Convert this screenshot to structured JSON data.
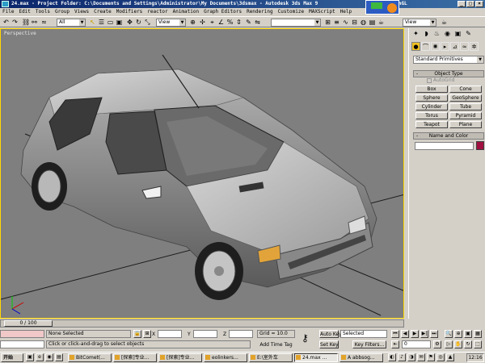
{
  "title": "24.max  - Project Folder: C:\\Documents and Settings\\Administrator\\My Documents\\3dsmax   - Autodesk 3ds Max 9",
  "opengl": "OpenGL",
  "menu": [
    "File",
    "Edit",
    "Tools",
    "Group",
    "Views",
    "Create",
    "Modifiers",
    "reactor",
    "Animation",
    "Graph Editors",
    "Rendering",
    "Customize",
    "MAXScript",
    "Help"
  ],
  "toolbar": {
    "filter": "All",
    "ref_coord": "View",
    "named_selection": "",
    "view_right": "View"
  },
  "viewport": {
    "label": "Perspective"
  },
  "command_panel": {
    "category": "Standard Primitives",
    "object_type": "Object Type",
    "autogrid": "AutoGrid",
    "objects": [
      "Box",
      "Cone",
      "Sphere",
      "GeoSphere",
      "Cylinder",
      "Tube",
      "Torus",
      "Pyramid",
      "Teapot",
      "Plane"
    ],
    "name_and_color": "Name and Color",
    "minus": "-"
  },
  "time_slider": "0 / 100",
  "status": {
    "selection": "None Selected",
    "prompt": "Click or click-and-drag to select objects",
    "x_label": "X",
    "y_label": "Y",
    "z_label": "Z",
    "grid": "Grid = 10.0",
    "add_time_tag": "Add Time Tag",
    "auto_key": "Auto Key",
    "set_key": "Set Key",
    "key_mode": "Selected",
    "key_filters": "Key Filters...",
    "frame": "0"
  },
  "taskbar": {
    "start": "开始",
    "tasks": [
      "BitComet(...",
      "[探索]专业...",
      "[探索]专业...",
      "eolinkers...",
      "E:\\室外车",
      "24.max ...",
      "A  abbsog..."
    ],
    "clock": "12:16"
  },
  "colors": {
    "viewport_bg": "#7f7f7f",
    "active_border": "#ffd700",
    "object_color": "#a01040"
  }
}
